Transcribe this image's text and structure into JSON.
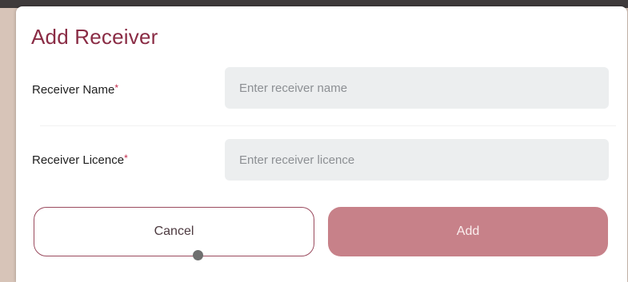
{
  "dialog": {
    "title": "Add Receiver",
    "fields": [
      {
        "label": "Receiver Name",
        "required_mark": "*",
        "placeholder": "Enter receiver name",
        "value": ""
      },
      {
        "label": "Receiver Licence",
        "required_mark": "*",
        "placeholder": "Enter receiver licence",
        "value": ""
      }
    ],
    "buttons": {
      "cancel_label": "Cancel",
      "add_label": "Add"
    }
  },
  "colors": {
    "title": "#8a2c45",
    "required": "#c2294a",
    "add_button": "#c78189",
    "cancel_border": "#9a4a5e",
    "input_bg": "#eceeef"
  }
}
